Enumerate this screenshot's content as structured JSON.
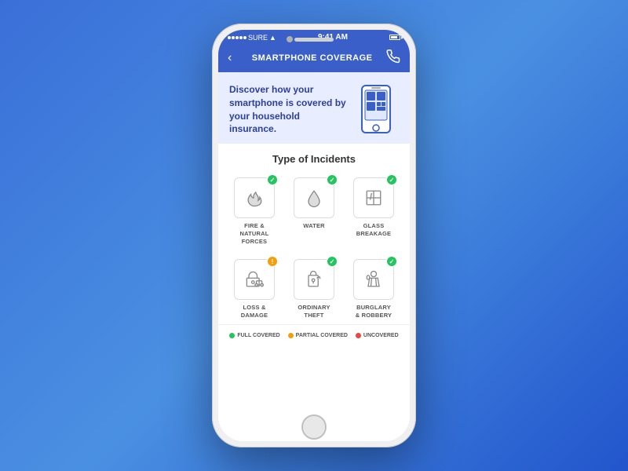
{
  "background": "#3a6fd8",
  "phone": {
    "status_bar": {
      "carrier": "SURE",
      "time": "9:41 AM",
      "wifi": true,
      "battery": 70
    },
    "nav": {
      "title": "SMARTPHONE COVERAGE",
      "back_label": "‹",
      "phone_icon": "📞"
    },
    "hero": {
      "text": "Discover how your smartphone is covered by your household insurance.",
      "image_alt": "smartphone illustration"
    },
    "incidents_section": {
      "title": "Type of Incidents",
      "items": [
        {
          "id": "fire",
          "label": "FIRE & NATURAL\nFORCES",
          "badge": "green",
          "badge_symbol": "✓"
        },
        {
          "id": "water",
          "label": "WATER",
          "badge": "green",
          "badge_symbol": "✓"
        },
        {
          "id": "glass",
          "label": "GLASS BREAKAGE",
          "badge": "green",
          "badge_symbol": "✓"
        },
        {
          "id": "loss",
          "label": "LOSS & DAMAGE",
          "badge": "orange",
          "badge_symbol": "!"
        },
        {
          "id": "theft",
          "label": "ORDINARY\nTHEFT",
          "badge": "green",
          "badge_symbol": "✓"
        },
        {
          "id": "burglary",
          "label": "BURGLARY\n& ROBBERY",
          "badge": "green",
          "badge_symbol": "✓"
        }
      ]
    },
    "legend": {
      "items": [
        {
          "id": "full",
          "color": "green",
          "label": "FULL COVERED"
        },
        {
          "id": "partial",
          "color": "orange",
          "label": "PARTIAL COVERED"
        },
        {
          "id": "uncovered",
          "color": "red",
          "label": "UNCOVERED"
        }
      ]
    }
  }
}
